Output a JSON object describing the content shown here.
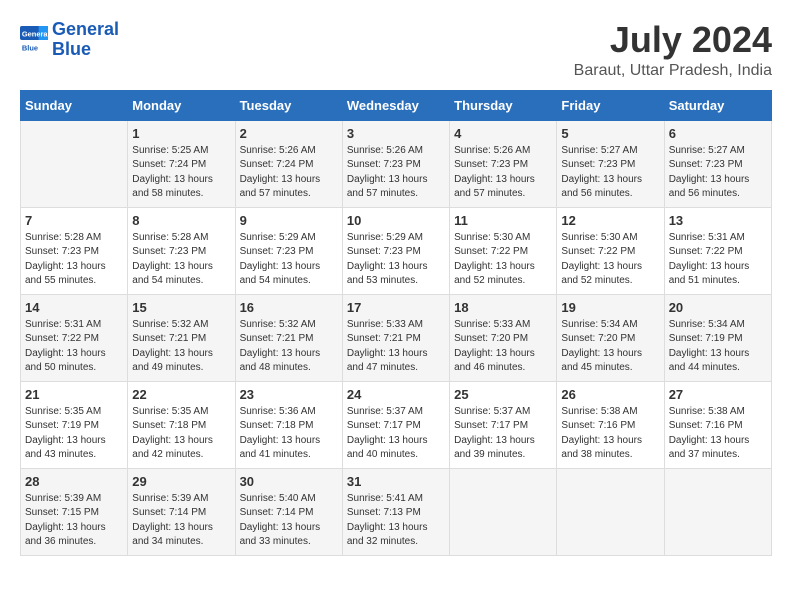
{
  "header": {
    "logo_line1": "General",
    "logo_line2": "Blue",
    "month_title": "July 2024",
    "location": "Baraut, Uttar Pradesh, India"
  },
  "weekdays": [
    "Sunday",
    "Monday",
    "Tuesday",
    "Wednesday",
    "Thursday",
    "Friday",
    "Saturday"
  ],
  "weeks": [
    [
      {
        "day": "",
        "info": ""
      },
      {
        "day": "1",
        "info": "Sunrise: 5:25 AM\nSunset: 7:24 PM\nDaylight: 13 hours\nand 58 minutes."
      },
      {
        "day": "2",
        "info": "Sunrise: 5:26 AM\nSunset: 7:24 PM\nDaylight: 13 hours\nand 57 minutes."
      },
      {
        "day": "3",
        "info": "Sunrise: 5:26 AM\nSunset: 7:23 PM\nDaylight: 13 hours\nand 57 minutes."
      },
      {
        "day": "4",
        "info": "Sunrise: 5:26 AM\nSunset: 7:23 PM\nDaylight: 13 hours\nand 57 minutes."
      },
      {
        "day": "5",
        "info": "Sunrise: 5:27 AM\nSunset: 7:23 PM\nDaylight: 13 hours\nand 56 minutes."
      },
      {
        "day": "6",
        "info": "Sunrise: 5:27 AM\nSunset: 7:23 PM\nDaylight: 13 hours\nand 56 minutes."
      }
    ],
    [
      {
        "day": "7",
        "info": "Sunrise: 5:28 AM\nSunset: 7:23 PM\nDaylight: 13 hours\nand 55 minutes."
      },
      {
        "day": "8",
        "info": "Sunrise: 5:28 AM\nSunset: 7:23 PM\nDaylight: 13 hours\nand 54 minutes."
      },
      {
        "day": "9",
        "info": "Sunrise: 5:29 AM\nSunset: 7:23 PM\nDaylight: 13 hours\nand 54 minutes."
      },
      {
        "day": "10",
        "info": "Sunrise: 5:29 AM\nSunset: 7:23 PM\nDaylight: 13 hours\nand 53 minutes."
      },
      {
        "day": "11",
        "info": "Sunrise: 5:30 AM\nSunset: 7:22 PM\nDaylight: 13 hours\nand 52 minutes."
      },
      {
        "day": "12",
        "info": "Sunrise: 5:30 AM\nSunset: 7:22 PM\nDaylight: 13 hours\nand 52 minutes."
      },
      {
        "day": "13",
        "info": "Sunrise: 5:31 AM\nSunset: 7:22 PM\nDaylight: 13 hours\nand 51 minutes."
      }
    ],
    [
      {
        "day": "14",
        "info": "Sunrise: 5:31 AM\nSunset: 7:22 PM\nDaylight: 13 hours\nand 50 minutes."
      },
      {
        "day": "15",
        "info": "Sunrise: 5:32 AM\nSunset: 7:21 PM\nDaylight: 13 hours\nand 49 minutes."
      },
      {
        "day": "16",
        "info": "Sunrise: 5:32 AM\nSunset: 7:21 PM\nDaylight: 13 hours\nand 48 minutes."
      },
      {
        "day": "17",
        "info": "Sunrise: 5:33 AM\nSunset: 7:21 PM\nDaylight: 13 hours\nand 47 minutes."
      },
      {
        "day": "18",
        "info": "Sunrise: 5:33 AM\nSunset: 7:20 PM\nDaylight: 13 hours\nand 46 minutes."
      },
      {
        "day": "19",
        "info": "Sunrise: 5:34 AM\nSunset: 7:20 PM\nDaylight: 13 hours\nand 45 minutes."
      },
      {
        "day": "20",
        "info": "Sunrise: 5:34 AM\nSunset: 7:19 PM\nDaylight: 13 hours\nand 44 minutes."
      }
    ],
    [
      {
        "day": "21",
        "info": "Sunrise: 5:35 AM\nSunset: 7:19 PM\nDaylight: 13 hours\nand 43 minutes."
      },
      {
        "day": "22",
        "info": "Sunrise: 5:35 AM\nSunset: 7:18 PM\nDaylight: 13 hours\nand 42 minutes."
      },
      {
        "day": "23",
        "info": "Sunrise: 5:36 AM\nSunset: 7:18 PM\nDaylight: 13 hours\nand 41 minutes."
      },
      {
        "day": "24",
        "info": "Sunrise: 5:37 AM\nSunset: 7:17 PM\nDaylight: 13 hours\nand 40 minutes."
      },
      {
        "day": "25",
        "info": "Sunrise: 5:37 AM\nSunset: 7:17 PM\nDaylight: 13 hours\nand 39 minutes."
      },
      {
        "day": "26",
        "info": "Sunrise: 5:38 AM\nSunset: 7:16 PM\nDaylight: 13 hours\nand 38 minutes."
      },
      {
        "day": "27",
        "info": "Sunrise: 5:38 AM\nSunset: 7:16 PM\nDaylight: 13 hours\nand 37 minutes."
      }
    ],
    [
      {
        "day": "28",
        "info": "Sunrise: 5:39 AM\nSunset: 7:15 PM\nDaylight: 13 hours\nand 36 minutes."
      },
      {
        "day": "29",
        "info": "Sunrise: 5:39 AM\nSunset: 7:14 PM\nDaylight: 13 hours\nand 34 minutes."
      },
      {
        "day": "30",
        "info": "Sunrise: 5:40 AM\nSunset: 7:14 PM\nDaylight: 13 hours\nand 33 minutes."
      },
      {
        "day": "31",
        "info": "Sunrise: 5:41 AM\nSunset: 7:13 PM\nDaylight: 13 hours\nand 32 minutes."
      },
      {
        "day": "",
        "info": ""
      },
      {
        "day": "",
        "info": ""
      },
      {
        "day": "",
        "info": ""
      }
    ]
  ]
}
